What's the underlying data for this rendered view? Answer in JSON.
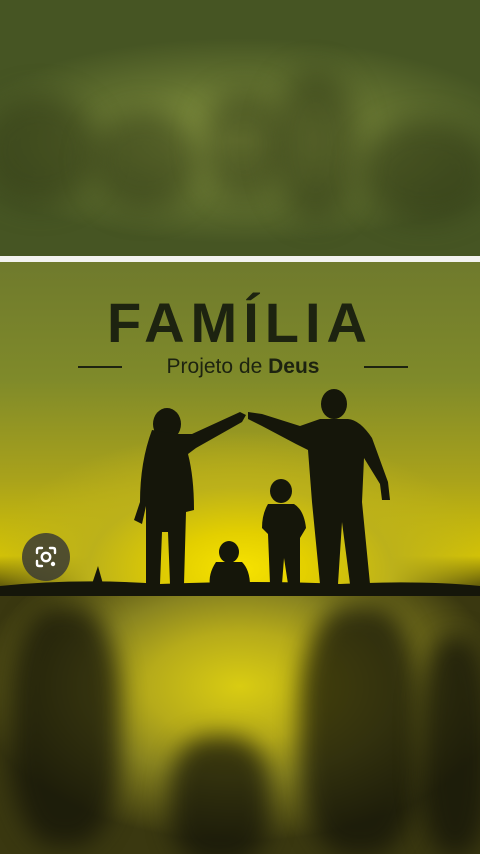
{
  "image": {
    "title": "FAMÍLIA",
    "subtitle_regular": "Projeto de ",
    "subtitle_bold": "Deus"
  },
  "lens_button": {
    "icon": "google-lens-icon"
  },
  "colors": {
    "sky_yellow": "#f7e300",
    "sky_green": "#7f8a2a",
    "text_dark": "#1d2310",
    "divider": "#f3f3f0"
  }
}
